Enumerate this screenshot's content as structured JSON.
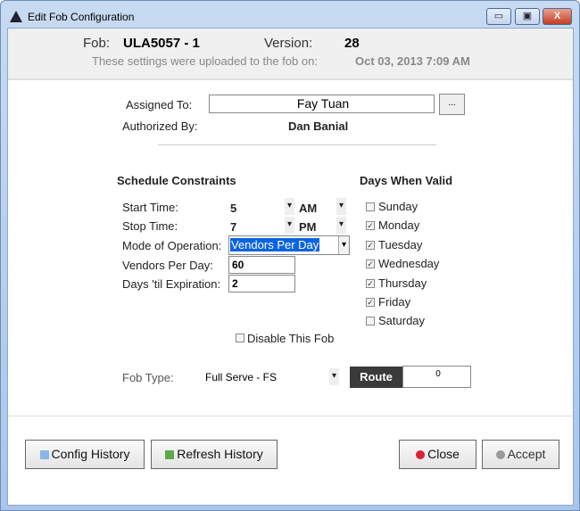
{
  "window": {
    "title": "Edit Fob Configuration",
    "minimize": "▭",
    "maximize": "▣",
    "close": "X"
  },
  "header": {
    "fob_label": "Fob:",
    "fob_value": "ULA5057 - 1",
    "version_label": "Version:",
    "version_value": "28",
    "upload_label": "These settings were uploaded to the fob on:",
    "upload_value": "Oct 03, 2013 7:09 AM"
  },
  "assigned": {
    "label": "Assigned To:",
    "value": "Fay Tuan",
    "browse": "...",
    "authorized_label": "Authorized By:",
    "authorized_value": "Dan Banial"
  },
  "schedule": {
    "heading": "Schedule Constraints",
    "start_label": "Start Time:",
    "start_hour": "5",
    "start_ampm": "AM",
    "stop_label": "Stop Time:",
    "stop_hour": "7",
    "stop_ampm": "PM",
    "mode_label": "Mode of Operation:",
    "mode_value": "Vendors Per Day",
    "vendors_label": "Vendors Per Day:",
    "vendors_value": "60",
    "expiration_label": "Days 'til Expiration:",
    "expiration_value": "2"
  },
  "days": {
    "heading": "Days When Valid",
    "items": [
      {
        "label": "Sunday",
        "checked": false
      },
      {
        "label": "Monday",
        "checked": true
      },
      {
        "label": "Tuesday",
        "checked": true
      },
      {
        "label": "Wednesday",
        "checked": true
      },
      {
        "label": "Thursday",
        "checked": true
      },
      {
        "label": "Friday",
        "checked": true
      },
      {
        "label": "Saturday",
        "checked": false
      }
    ]
  },
  "disable": {
    "label": "Disable This Fob",
    "checked": false
  },
  "fob_type": {
    "label": "Fob Type:",
    "value": "Full Serve - FS",
    "route_label": "Route",
    "route_value": "0"
  },
  "buttons": {
    "config_history": "Config History",
    "refresh_history": "Refresh History",
    "close": "Close",
    "accept": "Accept"
  },
  "colors": {
    "selection": "#0a64e0",
    "route_bg": "#3a3a3a"
  }
}
